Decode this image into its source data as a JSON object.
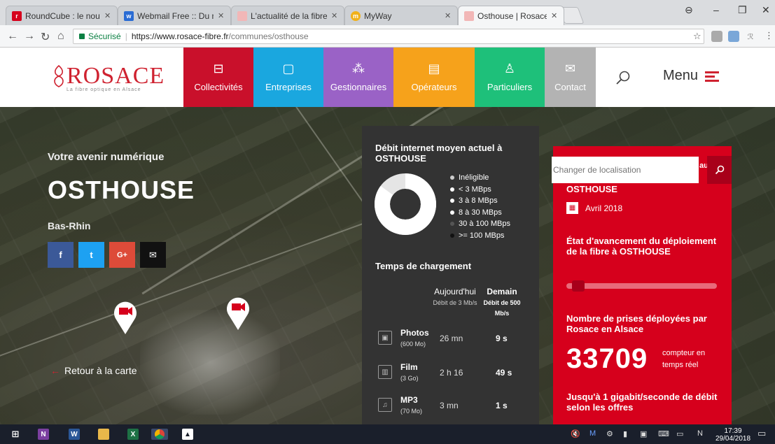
{
  "browser": {
    "tabs": [
      {
        "title": "RoundCube : le nouveau",
        "favicon_color": "#d6001c",
        "favicon_glyph": "r"
      },
      {
        "title": "Webmail Free :: Du nouve",
        "favicon_color": "#2a6cd4",
        "favicon_glyph": "w"
      },
      {
        "title": "L'actualité de la fibre opt",
        "favicon_color": "#f2b7b7",
        "favicon_glyph": "·"
      },
      {
        "title": "MyWay",
        "favicon_color": "#f1b11a",
        "favicon_glyph": "m"
      },
      {
        "title": "Osthouse | Rosace",
        "favicon_color": "#f2b7b7",
        "favicon_glyph": "·"
      }
    ],
    "active_tab": 4,
    "secure_label": "Sécurisé",
    "url_main": "https://www.rosace-fibre.fr",
    "url_path": "/communes/osthouse"
  },
  "site": {
    "logo_text": "ROSACE",
    "logo_tagline": "La fibre optique en Alsace",
    "nav": [
      {
        "label": "Collectivités",
        "color": "#c9102b",
        "icon": "building-icon"
      },
      {
        "label": "Entreprises",
        "color": "#1aa7df",
        "icon": "briefcase-icon"
      },
      {
        "label": "Gestionnaires",
        "color": "#9a62c6",
        "icon": "network-icon"
      },
      {
        "label": "Opérateurs",
        "color": "#f6a21b",
        "icon": "server-icon"
      },
      {
        "label": "Particuliers",
        "color": "#1ec07a",
        "icon": "people-icon"
      },
      {
        "label": "Contact",
        "color": "#b3b3b3",
        "icon": "envelope-icon"
      }
    ],
    "menu_label": "Menu"
  },
  "hero": {
    "subtitle": "Votre avenir numérique",
    "town": "OSTHOUSE",
    "department": "Bas-Rhin",
    "social": [
      {
        "name": "facebook",
        "glyph": "f",
        "color": "#3b5998"
      },
      {
        "name": "twitter",
        "glyph": "t",
        "color": "#1da1f2"
      },
      {
        "name": "google-plus",
        "glyph": "G+",
        "color": "#dd4b39"
      },
      {
        "name": "email",
        "glyph": "✉",
        "color": "#111111"
      }
    ],
    "back_label": "Retour à la carte"
  },
  "speed_panel": {
    "title": "Débit internet moyen actuel à OSTHOUSE",
    "legend": [
      {
        "label": "Inéligible",
        "color": "#cccccc"
      },
      {
        "label": "< 3 MBps",
        "color": "#ffffff"
      },
      {
        "label": "3 à 8 MBps",
        "color": "#ffffff"
      },
      {
        "label": "8 à 30 MBps",
        "color": "#ffffff"
      },
      {
        "label": "30 à 100 MBps",
        "color": "#555555"
      },
      {
        "label": ">= 100 MBps",
        "color": "#111111"
      }
    ],
    "donut_share_white": 0.85,
    "loading_title": "Temps de chargement",
    "col_today": "Aujourd'hui",
    "col_today_sub": "Débit de 3 Mb/s",
    "col_tomorrow": "Demain",
    "col_tomorrow_sub": "Débit de 500 Mb/s",
    "rows": [
      {
        "name": "Photos",
        "size": "(600 Mo)",
        "today": "26 mn",
        "tomorrow": "9 s",
        "icon": "photo-icon"
      },
      {
        "name": "Film",
        "size": "(3 Go)",
        "today": "2 h 16",
        "tomorrow": "49 s",
        "icon": "film-icon"
      },
      {
        "name": "MP3",
        "size": "(70 Mo)",
        "today": "3 mn",
        "tomorrow": "1 s",
        "icon": "music-icon"
      }
    ]
  },
  "fiber_panel": {
    "search_placeholder": "Changer de localisation",
    "search_peek": "au",
    "town": "OSTHOUSE",
    "date": "Avril 2018",
    "progress_heading": "État d'avancement du déploiement de la fibre à OSTHOUSE",
    "progress_value": 0.08,
    "count_heading": "Nombre de prises déployées par Rosace en Alsace",
    "count": "33709",
    "count_note_1": "compteur en",
    "count_note_2": "temps réel",
    "bottom_heading": "Jusqu'à 1 gigabit/seconde de débit selon les offres"
  },
  "taskbar": {
    "time": "17:39",
    "date": "29/04/2018"
  }
}
